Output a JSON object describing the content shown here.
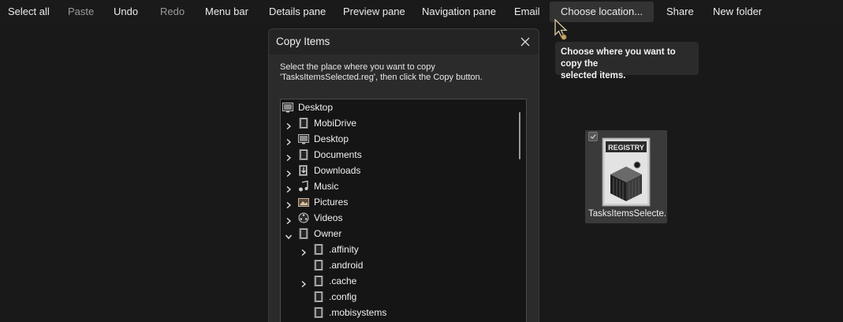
{
  "toolbar": {
    "select_all": "Select all",
    "paste": "Paste",
    "undo": "Undo",
    "redo": "Redo",
    "menu_bar": "Menu bar",
    "details_pane": "Details pane",
    "preview_pane": "Preview pane",
    "navigation_pane": "Navigation pane",
    "email": "Email",
    "choose_location": "Choose location...",
    "share": "Share",
    "new_folder": "New folder"
  },
  "tooltip": {
    "line1": "Choose where you want to copy the",
    "line2": "selected items."
  },
  "dialog": {
    "title": "Copy Items",
    "instruction_line1": "Select the place where you want to copy",
    "instruction_line2": "'TasksItemsSelected.reg', then click the Copy button.",
    "tree": [
      {
        "label": "Desktop",
        "icon": "desktop-icon",
        "chevron": "none"
      },
      {
        "label": "MobiDrive",
        "icon": "folder-icon",
        "chevron": "right"
      },
      {
        "label": "Desktop",
        "icon": "desktop-icon",
        "chevron": "right"
      },
      {
        "label": "Documents",
        "icon": "documents-icon",
        "chevron": "right"
      },
      {
        "label": "Downloads",
        "icon": "downloads-icon",
        "chevron": "right"
      },
      {
        "label": "Music",
        "icon": "music-icon",
        "chevron": "right"
      },
      {
        "label": "Pictures",
        "icon": "pictures-icon",
        "chevron": "right"
      },
      {
        "label": "Videos",
        "icon": "videos-icon",
        "chevron": "right"
      },
      {
        "label": "Owner",
        "icon": "folder-icon",
        "chevron": "down"
      },
      {
        "label": ".affinity",
        "icon": "folder-icon",
        "chevron": "right"
      },
      {
        "label": ".android",
        "icon": "folder-icon",
        "chevron": "none"
      },
      {
        "label": ".cache",
        "icon": "folder-icon",
        "chevron": "right"
      },
      {
        "label": ".config",
        "icon": "folder-icon",
        "chevron": "none"
      },
      {
        "label": ".mobisystems",
        "icon": "folder-icon",
        "chevron": "none"
      }
    ]
  },
  "file": {
    "name": "TasksItemsSelecte...",
    "icon": "registry-file-icon",
    "icon_text": "REGISTRY"
  },
  "colors": {
    "background": "#191919",
    "dialog_bg": "#2b2b2b",
    "tree_bg": "#151515",
    "tile_bg": "#3a3a3a"
  }
}
